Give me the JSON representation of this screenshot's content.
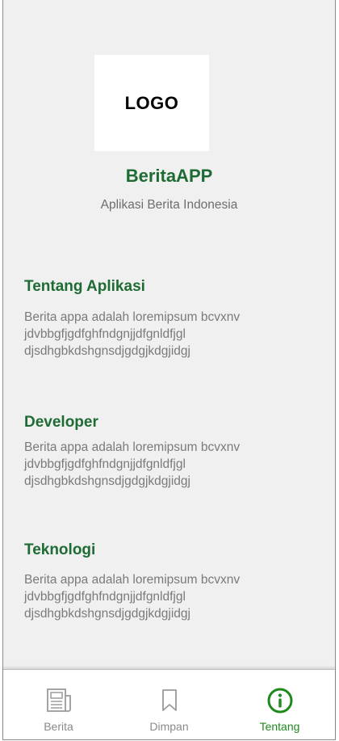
{
  "header": {
    "logo_text": "LOGO",
    "app_name": "BeritaAPP",
    "tagline": "Aplikasi Berita Indonesia"
  },
  "sections": [
    {
      "title": "Tentang Aplikasi",
      "lines": [
        "Berita appa adalah loremipsum bcvxnv",
        "jdvbbgfjgdfghfndgnjjdfgnldfjgl",
        "djsdhgbkdshgnsdjgdgjkdgjidgj"
      ]
    },
    {
      "title": "Developer",
      "lines": [
        "Berita appa adalah loremipsum bcvxnv",
        "jdvbbgfjgdfghfndgnjjdfgnldfjgl",
        "djsdhgbkdshgnsdjgdgjkdgjidgj"
      ]
    },
    {
      "title": "Teknologi",
      "lines": [
        "Berita appa adalah loremipsum bcvxnv",
        "jdvbbgfjgdfghfndgnjjdfgnldfjgl",
        "djsdhgbkdshgnsdjgdgjkdgjidgj"
      ]
    }
  ],
  "nav": {
    "items": [
      {
        "label": "Berita",
        "icon": "newspaper-icon",
        "active": false
      },
      {
        "label": "Dimpan",
        "icon": "bookmark-icon",
        "active": false
      },
      {
        "label": "Tentang",
        "icon": "info-icon",
        "active": true
      }
    ]
  },
  "colors": {
    "accent": "#1e6b34",
    "active_nav": "#1e8a1e",
    "background": "#f0f0f0",
    "muted_text": "#7a7a7a"
  }
}
